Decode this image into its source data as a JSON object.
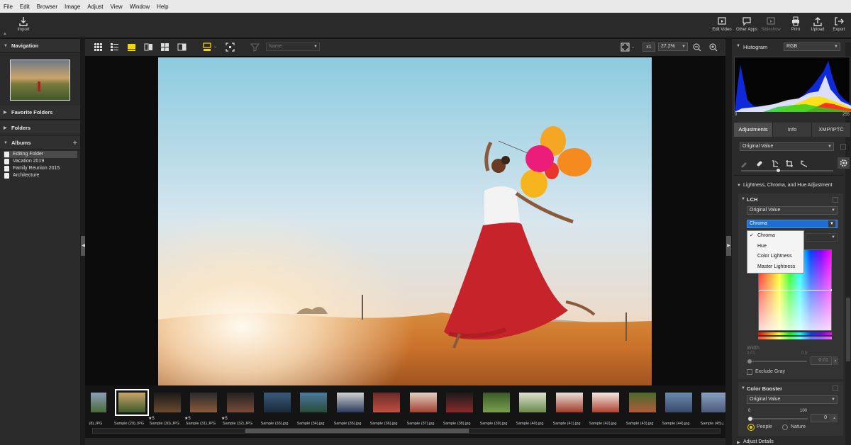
{
  "menu": [
    "File",
    "Edit",
    "Browser",
    "Image",
    "Adjust",
    "View",
    "Window",
    "Help"
  ],
  "toolbar": {
    "import": "Import",
    "right": [
      {
        "label": "Edit Video",
        "icon": "edit-video-icon"
      },
      {
        "label": "Other Apps",
        "icon": "other-apps-icon"
      },
      {
        "label": "Slideshow",
        "icon": "slideshow-icon"
      },
      {
        "label": "Print",
        "icon": "print-icon"
      },
      {
        "label": "Upload",
        "icon": "upload-icon"
      },
      {
        "label": "Export",
        "icon": "export-icon"
      }
    ]
  },
  "left": {
    "navigation": "Navigation",
    "favorite_folders": "Favorite Folders",
    "folders": "Folders",
    "albums": "Albums",
    "album_items": [
      "Editing Folder",
      "Vacation 2019",
      "Family Reunion 2015",
      "Architecture"
    ],
    "selected_album": "Editing Folder"
  },
  "viewbar": {
    "sort": "Name",
    "zoom_x": "x1",
    "zoom": "27.2%"
  },
  "filmstrip": {
    "labels": [
      "(8).JPG",
      "Sample (29).JPG",
      "Sample (30).JPG",
      "Sample (31).JPG",
      "Sample (32).JPG",
      "Sample (33).jpg",
      "Sample (34).jpg",
      "Sample (35).jpg",
      "Sample (36).jpg",
      "Sample (37).jpg",
      "Sample (38).jpg",
      "Sample (39).jpg",
      "Sample (40).jpg",
      "Sample (41).jpg",
      "Sample (42).jpg",
      "Sample (43).jpg",
      "Sample (44).jpg",
      "Sample (45).j"
    ],
    "stars": [
      "★5",
      "★5",
      "★5"
    ],
    "selected_index": 1
  },
  "right": {
    "histogram": "Histogram",
    "hist_channel": "RGB",
    "hist_min": "0",
    "hist_max": "255",
    "tabs": [
      "Adjustments",
      "Info",
      "XMP/IPTC"
    ],
    "active_tab": "Adjustments",
    "preset": "Original Value",
    "section_lch": "Lightness, Chroma, and Hue Adjustment",
    "lch": "LCH",
    "lch_preset": "Original Value",
    "lch_channel": "Chroma",
    "popup": [
      "Chroma",
      "Hue",
      "Color Lightness",
      "Master Lightness"
    ],
    "popup_checked": "Chroma",
    "width_label": "Width",
    "width_min": "0.01",
    "width_max": "0.5",
    "width_value": "0.01",
    "exclude_gray": "Exclude Gray",
    "color_booster": "Color Booster",
    "cb_preset": "Original Value",
    "cb_min": "0",
    "cb_max": "100",
    "cb_value": "0",
    "people": "People",
    "nature": "Nature",
    "adjust_details": "Adjust Details"
  },
  "colors": {
    "accent": "#1a6fd1",
    "bg": "#2b2b2b",
    "selected_yellow": "#f2d600"
  }
}
